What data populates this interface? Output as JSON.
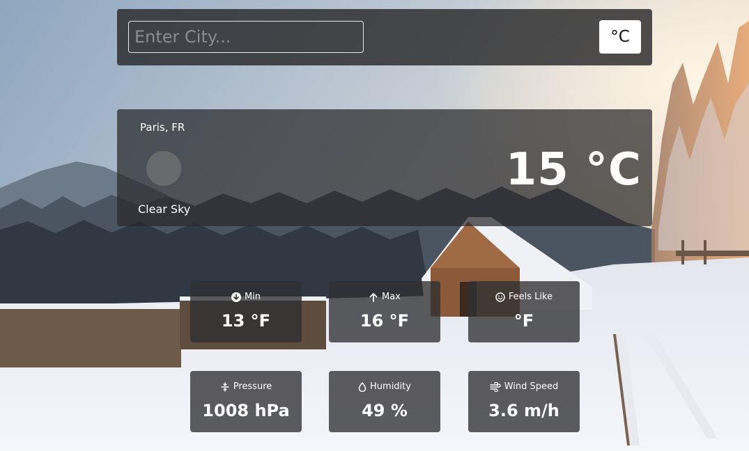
{
  "search": {
    "placeholder": "Enter City...",
    "value": ""
  },
  "unit_toggle": {
    "label": "°C"
  },
  "current": {
    "location": "Paris, FR",
    "condition": "Clear Sky",
    "temperature": "15 °C",
    "icon": "weather-icon-placeholder"
  },
  "details": [
    {
      "icon": "arrow-down-circle-icon",
      "label": "Min",
      "value": "13 °F"
    },
    {
      "icon": "arrow-up-icon",
      "label": "Max",
      "value": "16 °F"
    },
    {
      "icon": "smiley-icon",
      "label": "Feels Like",
      "value": "°F"
    },
    {
      "icon": "pressure-icon",
      "label": "Pressure",
      "value": "1008 hPa"
    },
    {
      "icon": "water-drop-icon",
      "label": "Humidity",
      "value": "49 %"
    },
    {
      "icon": "wind-icon",
      "label": "Wind Speed",
      "value": "3.6 m/h"
    }
  ],
  "colors": {
    "panel": "#28282a",
    "text": "#ffffff",
    "button_bg": "#ffffff"
  }
}
